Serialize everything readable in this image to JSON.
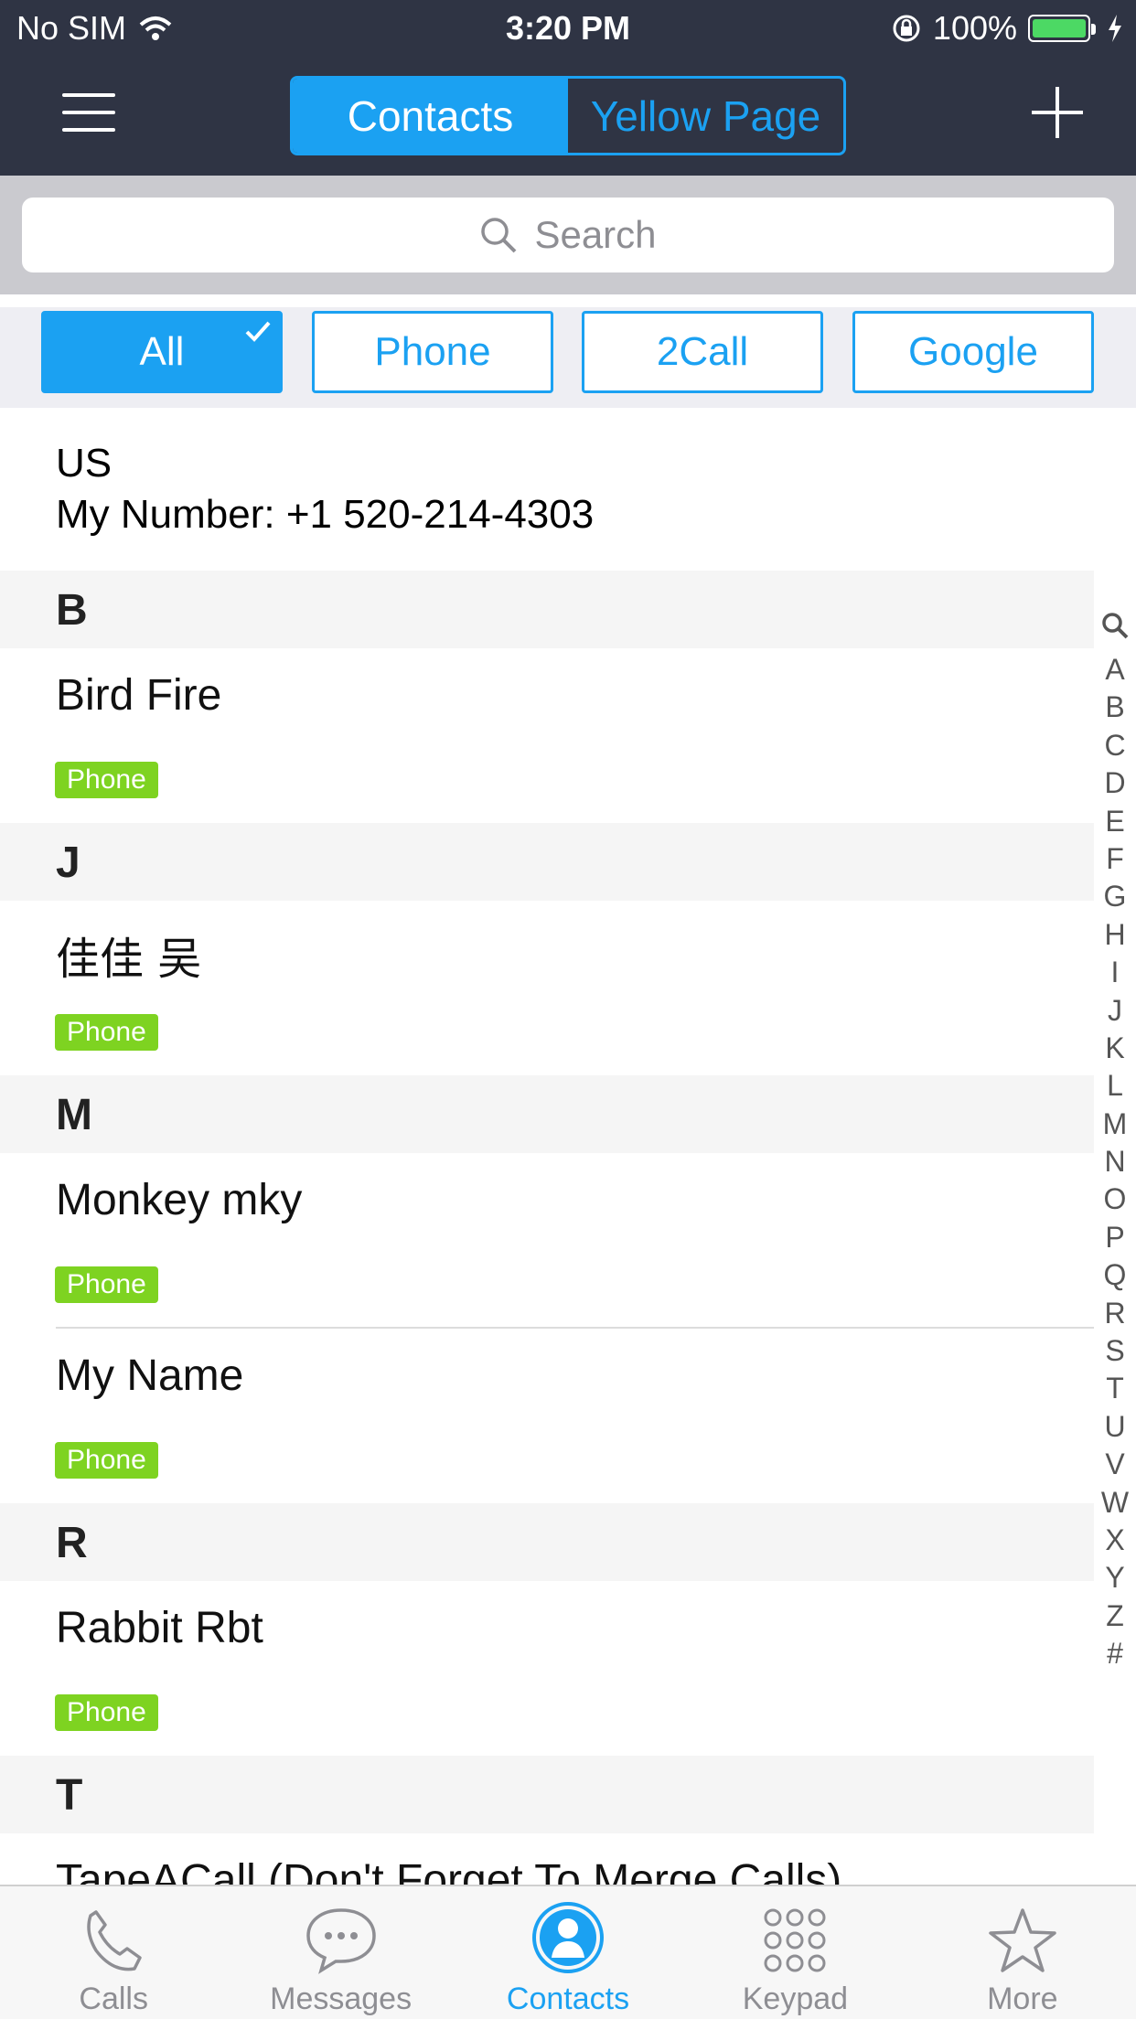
{
  "status": {
    "carrier": "No SIM",
    "time": "3:20 PM",
    "battery": "100%"
  },
  "nav": {
    "tabs": [
      "Contacts",
      "Yellow Page"
    ],
    "active": 0
  },
  "search": {
    "placeholder": "Search"
  },
  "filters": {
    "items": [
      "All",
      "Phone",
      "2Call",
      "Google"
    ],
    "active": 0
  },
  "my_number": {
    "country": "US",
    "line": "My Number: +1 520-214-4303"
  },
  "sections": [
    {
      "letter": "B",
      "contacts": [
        {
          "name": "Bird Fire",
          "tag": "Phone"
        }
      ]
    },
    {
      "letter": "J",
      "contacts": [
        {
          "name": "佳佳 吴",
          "tag": "Phone"
        }
      ]
    },
    {
      "letter": "M",
      "contacts": [
        {
          "name": "Monkey mky",
          "tag": "Phone"
        },
        {
          "name": "My Name",
          "tag": "Phone"
        }
      ]
    },
    {
      "letter": "R",
      "contacts": [
        {
          "name": "Rabbit Rbt",
          "tag": "Phone"
        }
      ]
    },
    {
      "letter": "T",
      "contacts": [
        {
          "name": "TapeACall (Don't Forget To Merge Calls)",
          "tag": ""
        }
      ]
    }
  ],
  "index": [
    "A",
    "B",
    "C",
    "D",
    "E",
    "F",
    "G",
    "H",
    "I",
    "J",
    "K",
    "L",
    "M",
    "N",
    "O",
    "P",
    "Q",
    "R",
    "S",
    "T",
    "U",
    "V",
    "W",
    "X",
    "Y",
    "Z",
    "#"
  ],
  "tabbar": {
    "items": [
      "Calls",
      "Messages",
      "Contacts",
      "Keypad",
      "More"
    ],
    "active": 2
  },
  "colors": {
    "accent": "#1ba1f2",
    "nav_bg": "#2f3444",
    "tag_green": "#7ed321"
  }
}
